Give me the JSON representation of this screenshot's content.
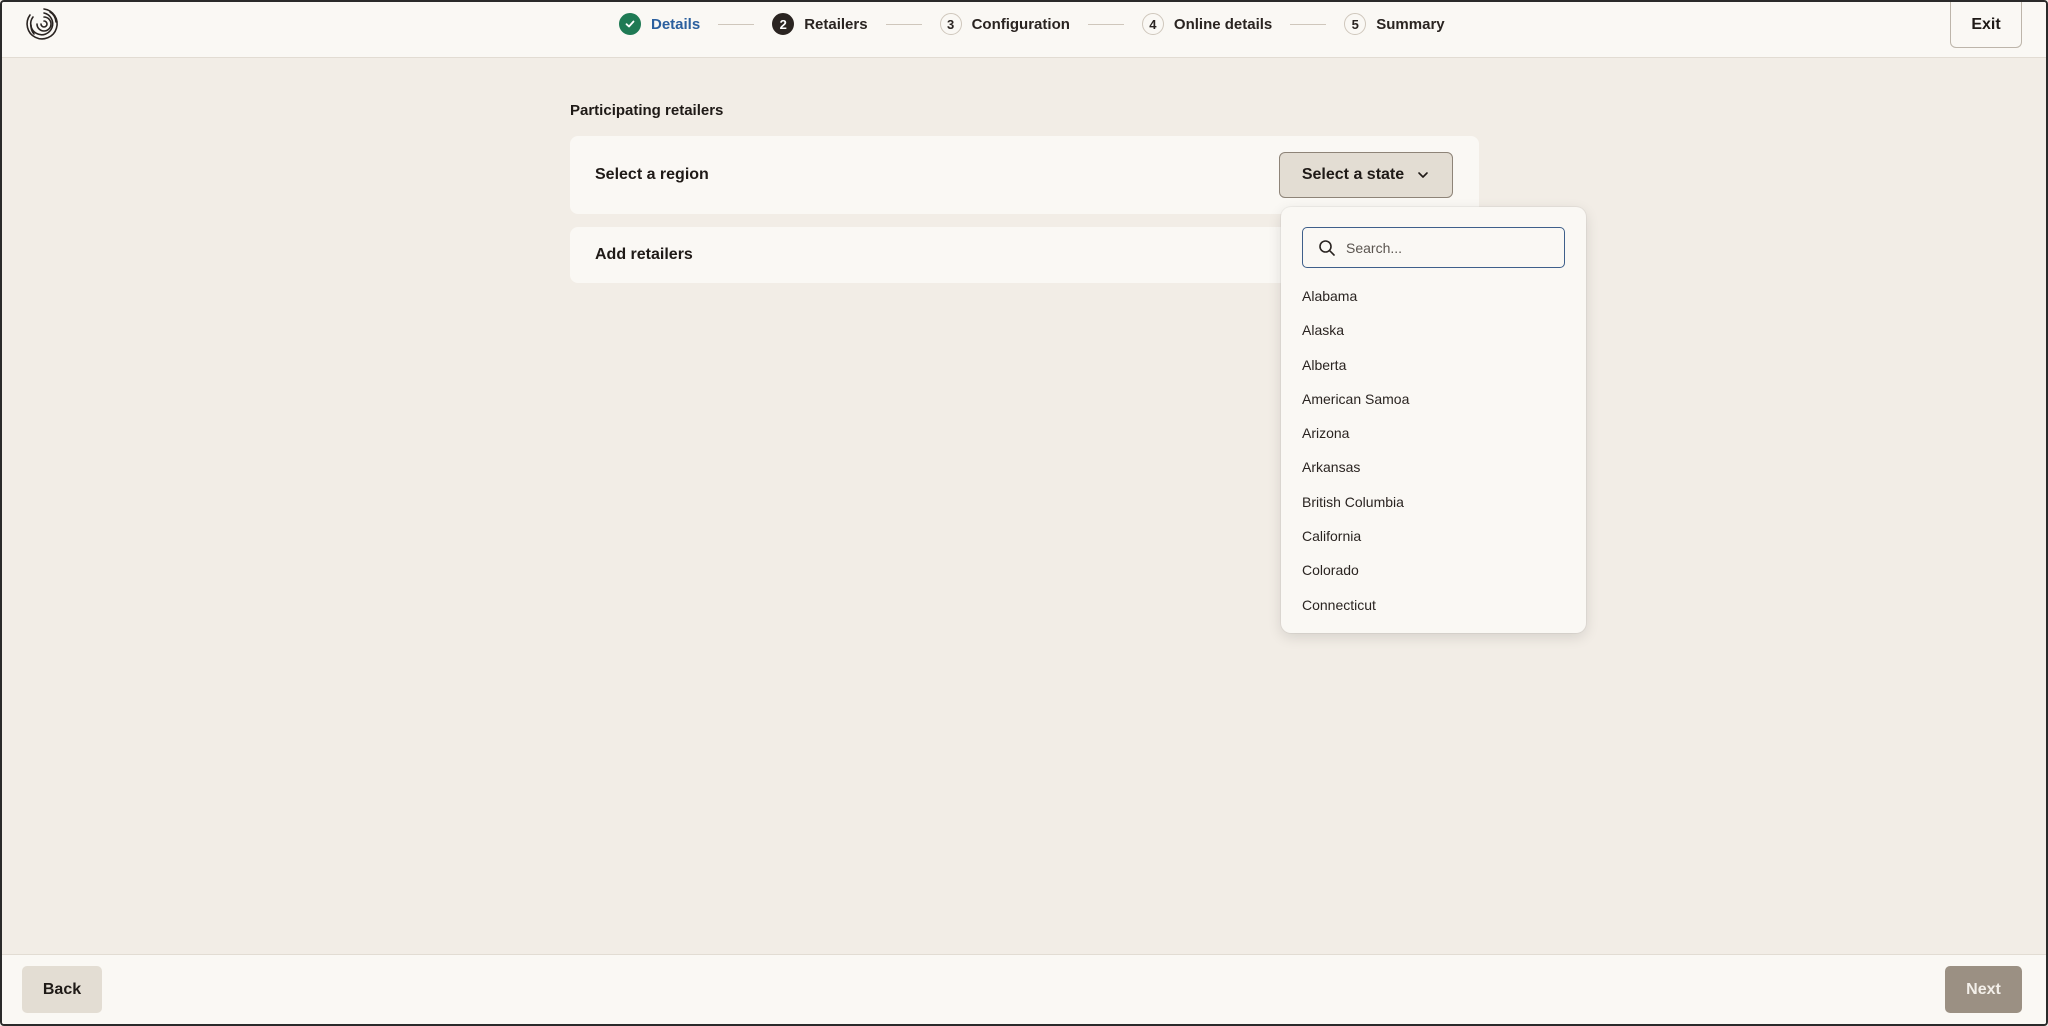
{
  "header": {
    "logo_icon": "spiral-logo-icon",
    "exit_label": "Exit",
    "steps": [
      {
        "number": "1",
        "label": "Details",
        "status": "done"
      },
      {
        "number": "2",
        "label": "Retailers",
        "status": "current"
      },
      {
        "number": "3",
        "label": "Configuration",
        "status": "upcoming"
      },
      {
        "number": "4",
        "label": "Online details",
        "status": "upcoming"
      },
      {
        "number": "5",
        "label": "Summary",
        "status": "upcoming"
      }
    ]
  },
  "main": {
    "section_title": "Participating retailers",
    "region_card_label": "Select a region",
    "state_button_label": "Select a state",
    "retailers_card_label": "Add retailers"
  },
  "dropdown": {
    "search_placeholder": "Search...",
    "search_value": "",
    "options": [
      "Alabama",
      "Alaska",
      "Alberta",
      "American Samoa",
      "Arizona",
      "Arkansas",
      "British Columbia",
      "California",
      "Colorado",
      "Connecticut"
    ]
  },
  "footer": {
    "back_label": "Back",
    "next_label": "Next"
  },
  "colors": {
    "page_bg": "#f2ede6",
    "surface": "#faf8f4",
    "done_green": "#1f7a54",
    "done_blue_text": "#2b5f9e",
    "search_border": "#3e5f8a",
    "next_disabled": "#9b9083"
  }
}
